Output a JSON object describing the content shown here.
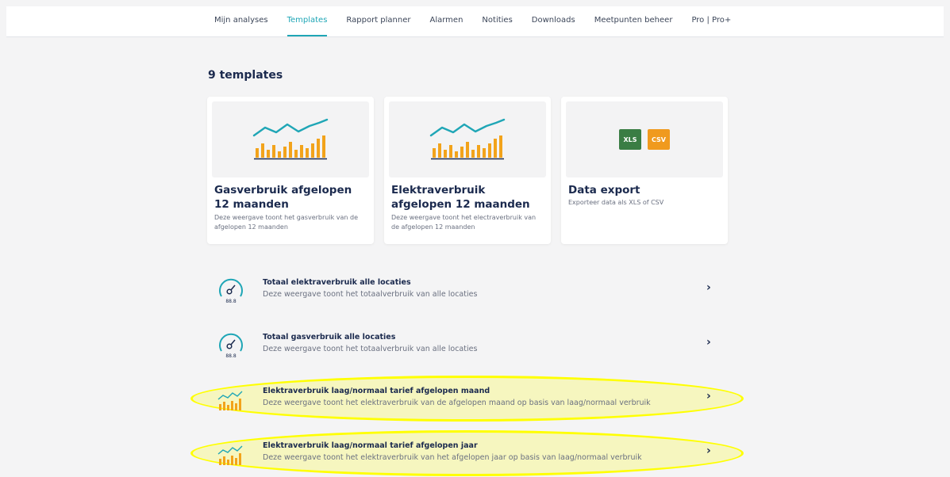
{
  "nav": {
    "tabs": [
      {
        "label": "Mijn analyses"
      },
      {
        "label": "Templates"
      },
      {
        "label": "Rapport planner"
      },
      {
        "label": "Alarmen"
      },
      {
        "label": "Notities"
      },
      {
        "label": "Downloads"
      },
      {
        "label": "Meetpunten beheer"
      },
      {
        "label": "Pro | Pro+"
      }
    ],
    "active_tab": "Templates"
  },
  "page": {
    "title": "9 templates"
  },
  "cards": [
    {
      "title": "Gasverbruik afgelopen 12 maanden",
      "description": "Deze weergave toont het gasverbruik van de afgelopen 12 maanden",
      "icon": "bar-line-chart-icon"
    },
    {
      "title": "Elektraverbruik afgelopen 12 maanden",
      "description": "Deze weergave toont het electraverbruik van de afgelopen 12 maanden",
      "icon": "bar-line-chart-icon"
    },
    {
      "title": "Data export",
      "description": "Exporteer data als XLS of CSV",
      "icon": "file-export-icon",
      "badges": [
        "XLS",
        "CSV"
      ]
    }
  ],
  "list": [
    {
      "title": "Totaal elektraverbruik alle locaties",
      "description": "Deze weergave toont het totaalverbruik van alle locaties",
      "icon": "gauge-icon",
      "icon_text": "88.8",
      "highlighted": false
    },
    {
      "title": "Totaal gasverbruik alle locaties",
      "description": "Deze weergave toont het totaalverbruik van alle locaties",
      "icon": "gauge-icon",
      "icon_text": "88.8",
      "highlighted": false
    },
    {
      "title": "Elektraverbruik laag/normaal tarief afgelopen maand",
      "description": "Deze weergave toont het elektraverbruik van de afgelopen maand op basis van laag/normaal verbruik",
      "icon": "bar-line-chart-icon",
      "highlighted": true
    },
    {
      "title": "Elektraverbruik laag/normaal tarief afgelopen jaar",
      "description": "Deze weergave toont het elektraverbruik van het afgelopen jaar op basis van laag/normaal verbruik",
      "icon": "bar-line-chart-icon",
      "highlighted": true
    }
  ],
  "colors": {
    "accent": "#1fa6b6",
    "bar": "#f2a31b",
    "navy": "#1b2a4e",
    "xls": "#3a7d44",
    "csv": "#f09a1e",
    "highlight": "#ffff00"
  }
}
